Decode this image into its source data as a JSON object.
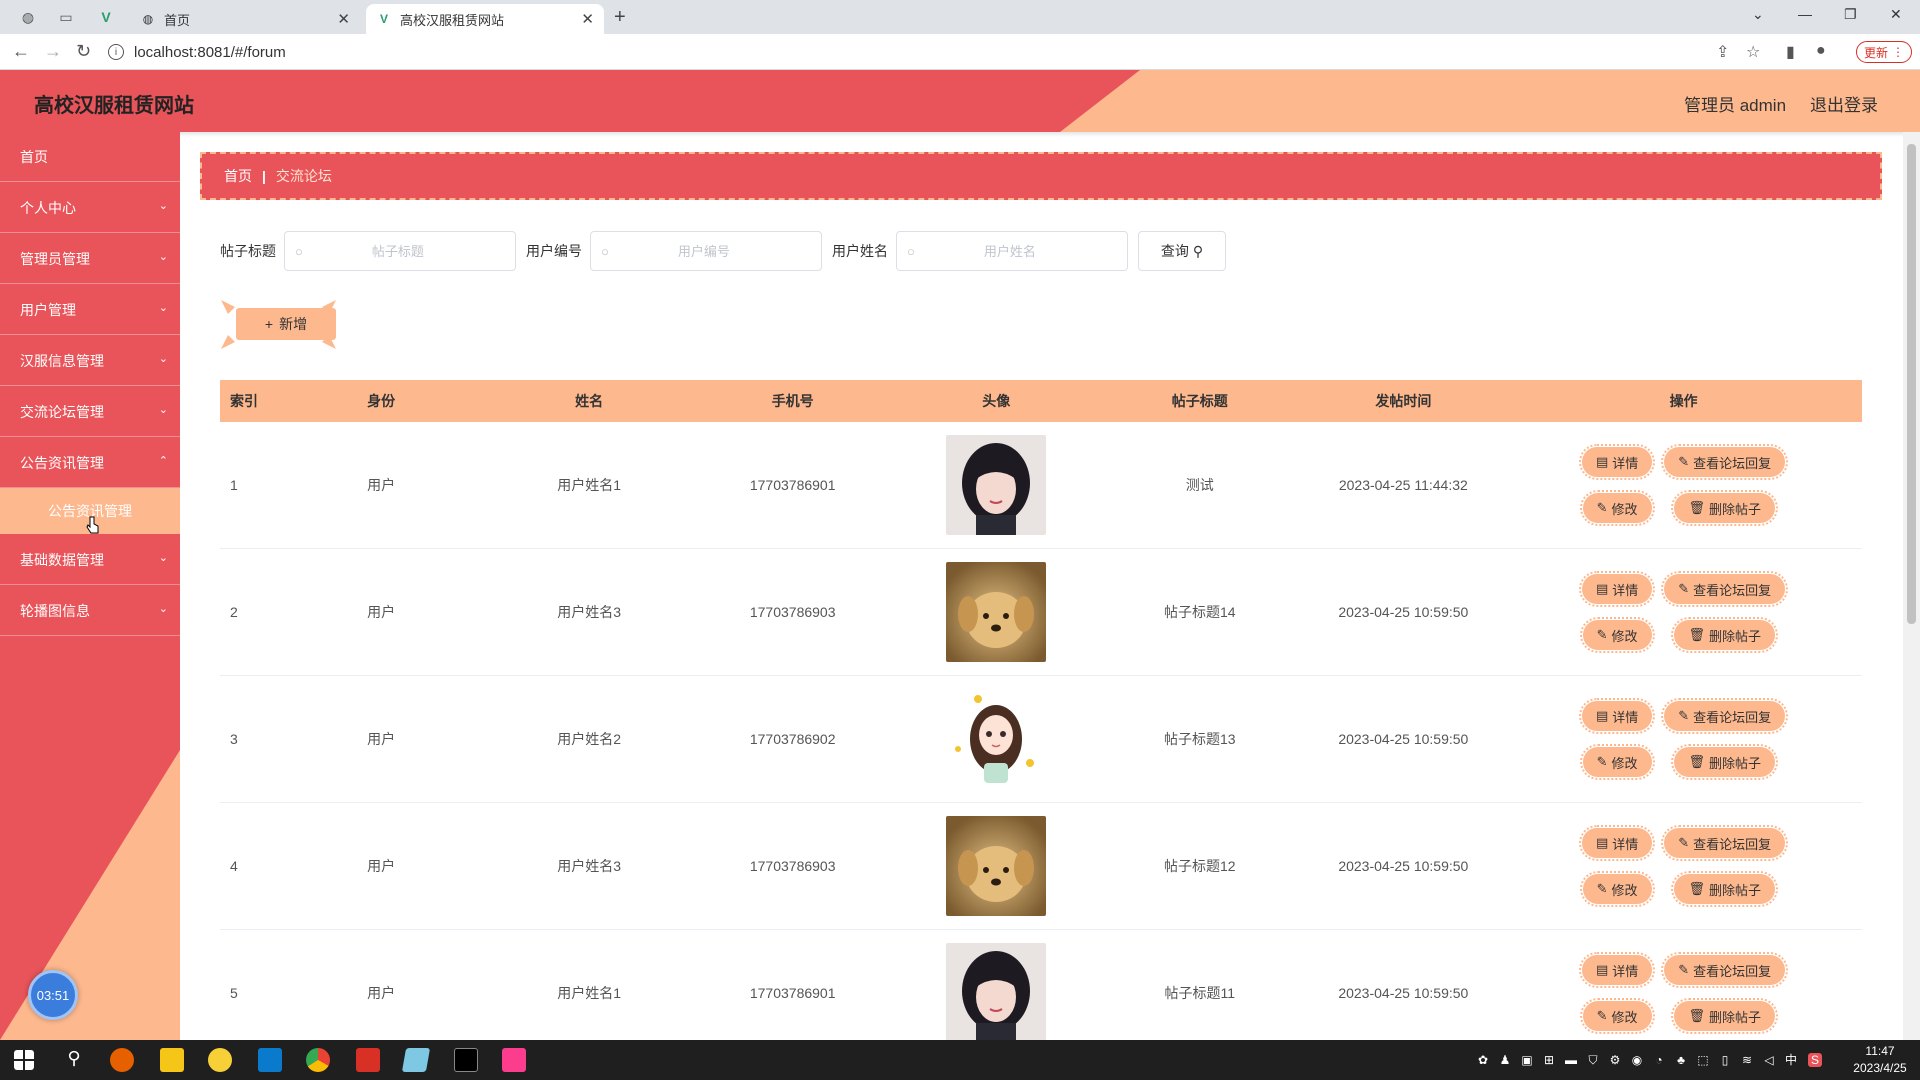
{
  "browser": {
    "tabs": [
      {
        "title": "首页",
        "active": false
      },
      {
        "title": "高校汉服租赁网站",
        "active": true
      }
    ],
    "url": "localhost:8081/#/forum",
    "update_label": "更新"
  },
  "header": {
    "title": "高校汉服租赁网站",
    "user_label": "管理员 admin",
    "logout_label": "退出登录"
  },
  "sidebar": {
    "items": [
      {
        "label": "首页",
        "expandable": false
      },
      {
        "label": "个人中心",
        "expandable": true
      },
      {
        "label": "管理员管理",
        "expandable": true
      },
      {
        "label": "用户管理",
        "expandable": true
      },
      {
        "label": "汉服信息管理",
        "expandable": true
      },
      {
        "label": "交流论坛管理",
        "expandable": true
      },
      {
        "label": "公告资讯管理",
        "expandable": true
      },
      {
        "label": "基础数据管理",
        "expandable": true
      },
      {
        "label": "轮播图信息",
        "expandable": true
      }
    ],
    "submenu_label": "公告资讯管理",
    "clock": "03:51"
  },
  "breadcrumb": {
    "home": "首页",
    "current": "交流论坛"
  },
  "search": {
    "title_label": "帖子标题",
    "title_placeholder": "帖子标题",
    "user_no_label": "用户编号",
    "user_no_placeholder": "用户编号",
    "user_name_label": "用户姓名",
    "user_name_placeholder": "用户姓名",
    "query_label": "查询"
  },
  "add_label": "新增",
  "table": {
    "headers": [
      "索引",
      "身份",
      "姓名",
      "手机号",
      "头像",
      "帖子标题",
      "发帖时间",
      "操作"
    ],
    "rows": [
      {
        "index": "1",
        "role": "用户",
        "name": "用户姓名1",
        "phone": "17703786901",
        "avatar": "girl-photo",
        "title": "测试",
        "time": "2023-04-25 11:44:32"
      },
      {
        "index": "2",
        "role": "用户",
        "name": "用户姓名3",
        "phone": "17703786903",
        "avatar": "puppy-photo",
        "title": "帖子标题14",
        "time": "2023-04-25 10:59:50"
      },
      {
        "index": "3",
        "role": "用户",
        "name": "用户姓名2",
        "phone": "17703786902",
        "avatar": "cartoon-girl",
        "title": "帖子标题13",
        "time": "2023-04-25 10:59:50"
      },
      {
        "index": "4",
        "role": "用户",
        "name": "用户姓名3",
        "phone": "17703786903",
        "avatar": "puppy-photo",
        "title": "帖子标题12",
        "time": "2023-04-25 10:59:50"
      },
      {
        "index": "5",
        "role": "用户",
        "name": "用户姓名1",
        "phone": "17703786901",
        "avatar": "girl-photo",
        "title": "帖子标题11",
        "time": "2023-04-25 10:59:50"
      }
    ],
    "actions": {
      "detail": "详情",
      "view_replies": "查看论坛回复",
      "edit": "修改",
      "delete": "删除帖子"
    }
  },
  "taskbar": {
    "time": "11:47",
    "date": "2023/4/25",
    "ime": "中"
  },
  "colors": {
    "primary": "#e85459",
    "accent": "#fdb88e"
  }
}
